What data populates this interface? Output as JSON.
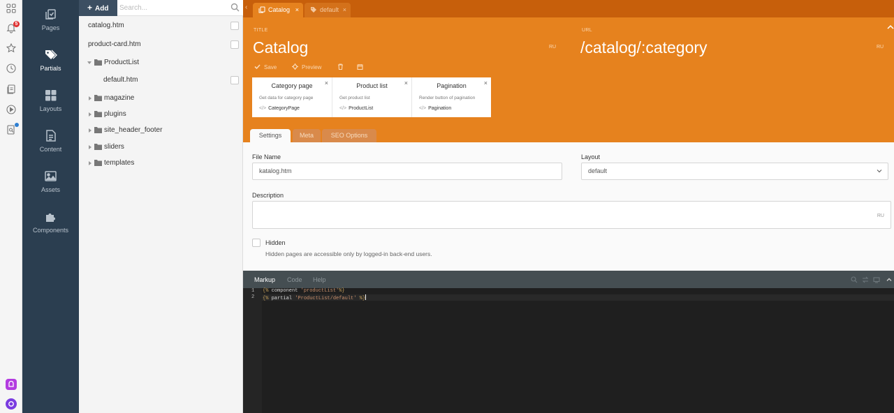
{
  "left_strip": {
    "notification_badge": "5",
    "icons": [
      "apps-grid-icon",
      "bell-icon",
      "star-icon",
      "clock-icon",
      "documents-icon",
      "play-icon",
      "search-doc-icon"
    ]
  },
  "nav": {
    "items": [
      {
        "label": "Pages",
        "icon": "pages-icon",
        "active": false
      },
      {
        "label": "Partials",
        "icon": "tags-icon",
        "active": true
      },
      {
        "label": "Layouts",
        "icon": "layouts-grid-icon",
        "active": false
      },
      {
        "label": "Content",
        "icon": "file-icon",
        "active": false
      },
      {
        "label": "Assets",
        "icon": "image-icon",
        "active": false
      },
      {
        "label": "Components",
        "icon": "puzzle-icon",
        "active": false
      }
    ]
  },
  "file_panel": {
    "add_label": "Add",
    "search_placeholder": "Search...",
    "items": [
      {
        "label": "catalog.htm",
        "type": "file"
      },
      {
        "label": "product-card.htm",
        "type": "file"
      },
      {
        "label": "ProductList",
        "type": "folder",
        "expanded": true
      },
      {
        "label": "default.htm",
        "type": "file",
        "indent": true
      },
      {
        "label": "magazine",
        "type": "folder"
      },
      {
        "label": "plugins",
        "type": "folder"
      },
      {
        "label": "site_header_footer",
        "type": "folder"
      },
      {
        "label": "sliders",
        "type": "folder"
      },
      {
        "label": "templates",
        "type": "folder"
      }
    ]
  },
  "tabs": [
    {
      "label": "Catalog",
      "active": true
    },
    {
      "label": "default",
      "active": false
    }
  ],
  "header": {
    "title_label": "TITLE",
    "title_value": "Catalog",
    "title_lang": "RU",
    "url_label": "URL",
    "url_value": "/catalog/:category",
    "url_lang": "RU",
    "toolbar": {
      "save": "Save",
      "preview": "Preview"
    },
    "accent_color": "#e6821e"
  },
  "components": [
    {
      "title": "Category page",
      "description": "Get data for category page",
      "alias": "CategoryPage"
    },
    {
      "title": "Product list",
      "description": "Get product list",
      "alias": "ProductList"
    },
    {
      "title": "Pagination",
      "description": "Render button of pagination",
      "alias": "Pagination"
    }
  ],
  "form_tabs": [
    "Settings",
    "Meta",
    "SEO Options"
  ],
  "form": {
    "file_name_label": "File Name",
    "file_name_value": "katalog.htm",
    "layout_label": "Layout",
    "layout_value": "default",
    "description_label": "Description",
    "description_lang": "RU",
    "hidden_label": "Hidden",
    "hidden_help": "Hidden pages are accessible only by logged-in back-end users."
  },
  "editor": {
    "tabs": [
      "Markup",
      "Code",
      "Help"
    ],
    "active_tab": "Markup",
    "lines": [
      {
        "number": "1",
        "text": "{% component 'productList'%}"
      },
      {
        "number": "2",
        "text": "{% partial 'ProductList/default' %}"
      }
    ]
  }
}
